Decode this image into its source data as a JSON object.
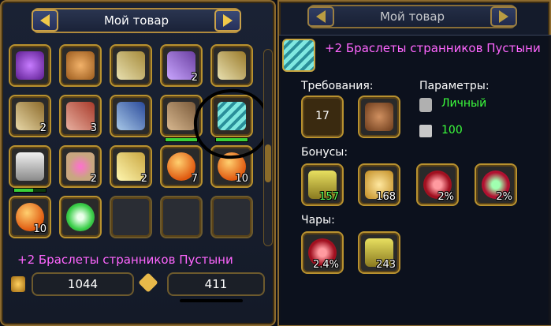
{
  "left_panel": {
    "title": "Мой товар",
    "grid": [
      {
        "icon": "purple-bag-icon",
        "count": ""
      },
      {
        "icon": "bread-icon",
        "count": ""
      },
      {
        "icon": "scroll-icon",
        "count": ""
      },
      {
        "icon": "purple-scroll-icon",
        "count": "2"
      },
      {
        "icon": "scroll-icon",
        "count": ""
      },
      {
        "icon": "scroll-icon",
        "count": "2"
      },
      {
        "icon": "red-scroll-icon",
        "count": "3"
      },
      {
        "icon": "blue-scroll-icon",
        "count": ""
      },
      {
        "icon": "glove-icon",
        "count": "",
        "bar": 1.0
      },
      {
        "icon": "bracelet-icon",
        "count": "",
        "bar": 1.0
      },
      {
        "icon": "boots-icon",
        "count": "",
        "bar": 0.6
      },
      {
        "icon": "heart-scroll-icon",
        "count": "2"
      },
      {
        "icon": "feather-icon",
        "count": "2"
      },
      {
        "icon": "orange-orb-icon",
        "count": "7"
      },
      {
        "icon": "orange-orb-icon",
        "count": "10"
      },
      {
        "icon": "orange-orb-icon",
        "count": "10"
      },
      {
        "icon": "green-plus-icon",
        "count": ""
      },
      {
        "icon": "empty",
        "count": ""
      },
      {
        "icon": "empty",
        "count": ""
      },
      {
        "icon": "empty",
        "count": ""
      }
    ],
    "selected_name": "+2 Браслеты странников Пустыни",
    "price": "1044",
    "quantity": "411"
  },
  "right_panel": {
    "title": "Мой товар",
    "item_name": "+2 Браслеты странников Пустыни",
    "requirements_label": "Требования:",
    "params_label": "Параметры:",
    "req_level": "17",
    "param_personal": "Личный",
    "param_durability": "100",
    "bonuses_label": "Бонусы:",
    "bonuses": [
      "157",
      "168",
      "2%",
      "2%"
    ],
    "charms_label": "Чары:",
    "charms": [
      "2.4%",
      "243"
    ]
  }
}
